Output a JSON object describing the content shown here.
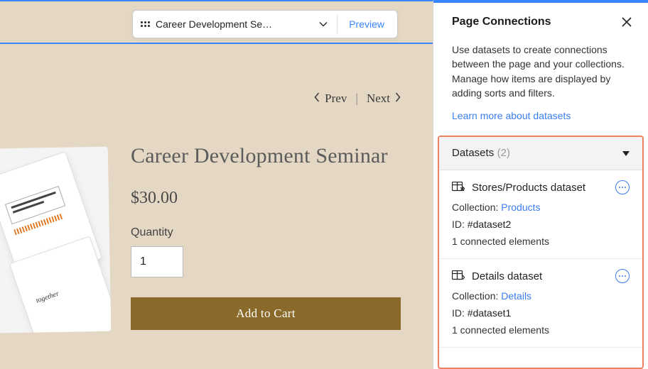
{
  "floatingBar": {
    "title": "Career Development Se…",
    "previewLabel": "Preview"
  },
  "nav": {
    "prev": "Prev",
    "next": "Next"
  },
  "product": {
    "title": "Career Development Seminar",
    "price": "$30.00",
    "quantityLabel": "Quantity",
    "quantityValue": "1",
    "addToCart": "Add to Cart"
  },
  "panel": {
    "title": "Page Connections",
    "description": "Use datasets to create connections between the page and your collections. Manage how items are displayed by adding sorts and filters.",
    "learnMore": "Learn more about datasets",
    "sectionTitle": "Datasets",
    "sectionCount": "(2)",
    "collectionLabel": "Collection:",
    "idLabel": "ID:",
    "datasets": [
      {
        "name": "Stores/Products dataset",
        "collection": "Products",
        "id": "#dataset2",
        "connected": "1 connected elements"
      },
      {
        "name": "Details dataset",
        "collection": "Details",
        "id": "#dataset1",
        "connected": "1 connected elements"
      }
    ]
  },
  "colors": {
    "accent": "#3885ff",
    "highlight": "#f08060",
    "buttonBg": "#8a6a2a"
  }
}
